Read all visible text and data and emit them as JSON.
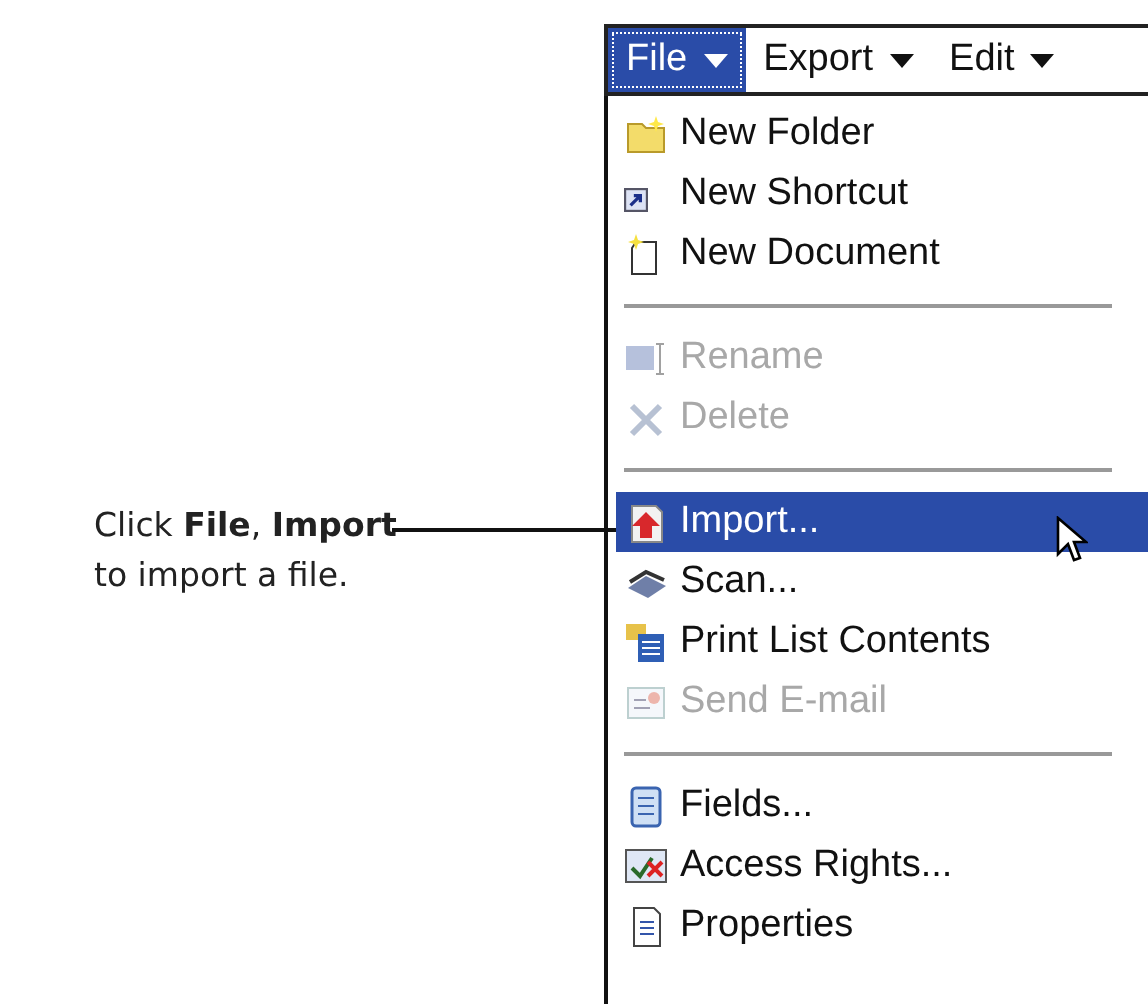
{
  "callout": {
    "lines": [
      "Click **File**, **Import**",
      "to import a file."
    ]
  },
  "menu_bar": [
    {
      "label": "File",
      "selected": true
    },
    {
      "label": "Export",
      "selected": false
    },
    {
      "label": "Edit",
      "selected": false
    }
  ],
  "menu_items": [
    {
      "kind": "item",
      "label": "New Folder",
      "disabled": false,
      "selected": false
    },
    {
      "kind": "item",
      "label": "New Shortcut",
      "disabled": false,
      "selected": false
    },
    {
      "kind": "item",
      "label": "New Document",
      "disabled": false,
      "selected": false
    },
    {
      "kind": "separator"
    },
    {
      "kind": "item",
      "label": "Rename",
      "disabled": true,
      "selected": false
    },
    {
      "kind": "item",
      "label": "Delete",
      "disabled": true,
      "selected": false
    },
    {
      "kind": "separator"
    },
    {
      "kind": "item",
      "label": "Import...",
      "disabled": false,
      "selected": true
    },
    {
      "kind": "item",
      "label": "Scan...",
      "disabled": false,
      "selected": false
    },
    {
      "kind": "item",
      "label": "Print List Contents",
      "disabled": false,
      "selected": false
    },
    {
      "kind": "item",
      "label": "Send E-mail",
      "disabled": true,
      "selected": false
    },
    {
      "kind": "separator"
    },
    {
      "kind": "item",
      "label": "Fields...",
      "disabled": false,
      "selected": false
    },
    {
      "kind": "item",
      "label": "Access Rights...",
      "disabled": false,
      "selected": false
    },
    {
      "kind": "item",
      "label": "Properties",
      "disabled": false,
      "selected": false
    }
  ]
}
